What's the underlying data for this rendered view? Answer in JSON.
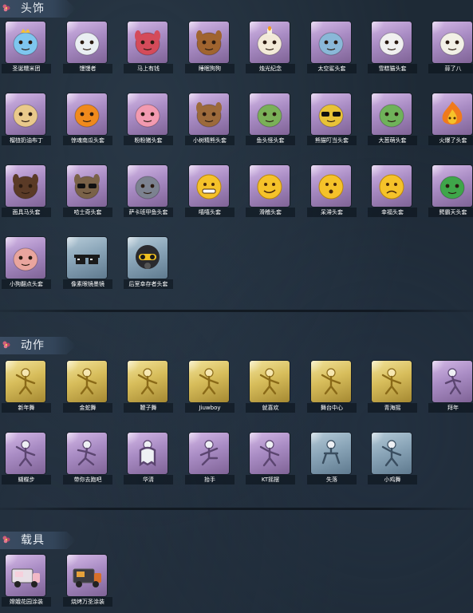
{
  "sections": [
    {
      "title": "头饰",
      "items": [
        {
          "label": "圣诞糯米团",
          "rarity": "purple",
          "icon": "cute-ghost-crown-icon",
          "color": "#7ec6ef"
        },
        {
          "label": "馒馒者",
          "rarity": "purple",
          "icon": "white-fluffy-creature-icon",
          "color": "#e9eef2"
        },
        {
          "label": "马上有钱",
          "rarity": "purple",
          "icon": "red-horse-head-icon",
          "color": "#d44b5a"
        },
        {
          "label": "睡眠狗狗",
          "rarity": "purple",
          "icon": "dog-head-icon",
          "color": "#a0642f"
        },
        {
          "label": "烛光纪念",
          "rarity": "purple",
          "icon": "candle-head-icon",
          "color": "#f2ead8"
        },
        {
          "label": "太空鲨头套",
          "rarity": "purple",
          "icon": "shark-head-icon",
          "color": "#8ab8d8"
        },
        {
          "label": "雪糕猫头套",
          "rarity": "purple",
          "icon": "white-cat-hat-icon",
          "color": "#f0f0f0"
        },
        {
          "label": "蒜了八",
          "rarity": "purple",
          "icon": "garlic-head-icon",
          "color": "#f2f0e6"
        },
        {
          "label": "榴梿奶油布丁",
          "rarity": "purple",
          "icon": "pudding-head-icon",
          "color": "#e9c98b"
        },
        {
          "label": "惊魂南瓜头套",
          "rarity": "purple",
          "icon": "pumpkin-head-icon",
          "color": "#f08a1c"
        },
        {
          "label": "粉粉猪头套",
          "rarity": "purple",
          "icon": "pink-pig-head-icon",
          "color": "#f29ab0"
        },
        {
          "label": "小树精熊头套",
          "rarity": "purple",
          "icon": "brown-bear-head-icon",
          "color": "#9c6a3b"
        },
        {
          "label": "鱼头怪头套",
          "rarity": "purple",
          "icon": "green-fish-head-icon",
          "color": "#7ab058"
        },
        {
          "label": "熊猫叮当头套",
          "rarity": "purple",
          "icon": "yellow-creature-sunglasses-icon",
          "color": "#e8c237"
        },
        {
          "label": "大葱萌头套",
          "rarity": "purple",
          "icon": "green-onion-head-icon",
          "color": "#6fb25a"
        },
        {
          "label": "火爆了头套",
          "rarity": "purple",
          "icon": "fire-head-icon",
          "color": "#f07a1c"
        },
        {
          "label": "面具马头套",
          "rarity": "purple",
          "icon": "horse-mask-icon",
          "color": "#5a3a26"
        },
        {
          "label": "哈士奇头套",
          "rarity": "purple",
          "icon": "husky-sunglasses-icon",
          "color": "#7a6248"
        },
        {
          "label": "萨卡班甲鱼头套",
          "rarity": "purple",
          "icon": "grey-fish-head-icon",
          "color": "#7c8290"
        },
        {
          "label": "嘻嘻头套",
          "rarity": "purple",
          "icon": "grin-emoji-icon",
          "color": "#f5c22a"
        },
        {
          "label": "滑稽头套",
          "rarity": "purple",
          "icon": "smirk-emoji-icon",
          "color": "#f5c22a"
        },
        {
          "label": "呆滞头套",
          "rarity": "purple",
          "icon": "dazed-emoji-icon",
          "color": "#f5c22a"
        },
        {
          "label": "幸福头套",
          "rarity": "purple",
          "icon": "sad-emoji-icon",
          "color": "#f5c22a"
        },
        {
          "label": "鳄霸天头套",
          "rarity": "purple",
          "icon": "crocodile-head-icon",
          "color": "#3fa64a"
        },
        {
          "label": "小狗翻点头套",
          "rarity": "purple",
          "icon": "pink-creature-head-icon",
          "color": "#e9a59e"
        },
        {
          "label": "像素眼镜墨镜",
          "rarity": "blue",
          "icon": "pixel-sunglasses-icon",
          "color": "#1a1a1a"
        },
        {
          "label": "后室幸存者头套",
          "rarity": "blue",
          "icon": "gas-mask-helmet-icon",
          "color": "#2a2a2e"
        }
      ]
    },
    {
      "title": "动作",
      "items": [
        {
          "label": "新年舞",
          "rarity": "gold",
          "icon": "dance-pose-icon"
        },
        {
          "label": "金蛇舞",
          "rarity": "gold",
          "icon": "dance-pose-icon"
        },
        {
          "label": "鞭子舞",
          "rarity": "gold",
          "icon": "dance-pose-icon"
        },
        {
          "label": "Jiuwboy",
          "rarity": "gold",
          "icon": "dance-pose-icon"
        },
        {
          "label": "就喜欢",
          "rarity": "gold",
          "icon": "dance-pose-icon"
        },
        {
          "label": "舞台中心",
          "rarity": "gold",
          "icon": "dance-pose-icon"
        },
        {
          "label": "青海摇",
          "rarity": "gold",
          "icon": "dance-pose-icon"
        },
        {
          "label": "拜年",
          "rarity": "purple",
          "icon": "bow-pose-icon"
        },
        {
          "label": "蝴蝶步",
          "rarity": "purple",
          "icon": "dance-pose-icon"
        },
        {
          "label": "带你去跑吧",
          "rarity": "purple",
          "icon": "run-pose-icon"
        },
        {
          "label": "华清",
          "rarity": "purple",
          "icon": "ghost-pose-icon"
        },
        {
          "label": "抬手",
          "rarity": "purple",
          "icon": "sit-pose-icon"
        },
        {
          "label": "KT摇摆",
          "rarity": "purple",
          "icon": "dance-pose-icon"
        },
        {
          "label": "失落",
          "rarity": "blue",
          "icon": "crawl-pose-icon"
        },
        {
          "label": "小鸡舞",
          "rarity": "blue",
          "icon": "dance-pose-icon"
        }
      ]
    },
    {
      "title": "载具",
      "items": [
        {
          "label": "嫦娥花园涂装",
          "rarity": "purple",
          "icon": "ice-cream-truck-icon",
          "color": "#e8dfe6"
        },
        {
          "label": "烧烤万圣涂装",
          "rarity": "purple",
          "icon": "food-truck-icon",
          "color": "#3b3b42"
        }
      ]
    }
  ],
  "colors": {
    "background": "#1e2a36",
    "header": "#3b4c62",
    "header_text": "#e8edf2",
    "card_purple": "#a98cc4",
    "card_gold": "#d7bd5b",
    "card_blue": "#8aa5b8"
  }
}
